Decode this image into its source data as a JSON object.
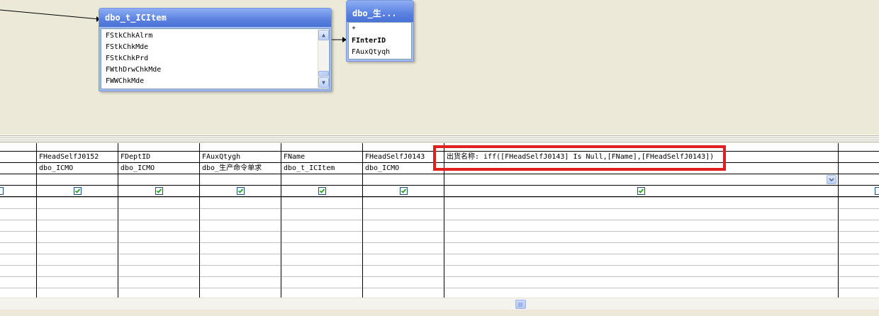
{
  "diagram": {
    "tables": [
      {
        "title": "dbo_t_ICItem",
        "rows": [
          "FStkChkAlrm",
          "FStkChkMde",
          "FStkChkPrd",
          "FWthDrwChkMde",
          "FWWChkMde"
        ]
      },
      {
        "title": "dbo_生...",
        "rows": [
          "*",
          "FInterID",
          "FAuxQtyqh"
        ],
        "bold_row": "FInterID"
      }
    ]
  },
  "grid": {
    "columns": [
      {
        "field": "FHeadSelfJ0152",
        "table": "dbo_ICMO",
        "output": true
      },
      {
        "field": "FDeptID",
        "table": "dbo_ICMO",
        "output": true
      },
      {
        "field": "FAuxQtygh",
        "table": "dbo_生产命令单求",
        "output": true
      },
      {
        "field": "FName",
        "table": "dbo_t_ICItem",
        "output": true
      },
      {
        "field": "FHeadSelfJ0143",
        "table": "dbo_ICMO",
        "output": true
      },
      {
        "field": "出货名称: iff([FHeadSelfJ0143] Is Null,[FName],[FHeadSelfJ0143])",
        "table": "",
        "output": true
      }
    ]
  },
  "colors": {
    "title_bar": "#5b82e0",
    "highlight": "#e02020",
    "check": "#21a121"
  }
}
